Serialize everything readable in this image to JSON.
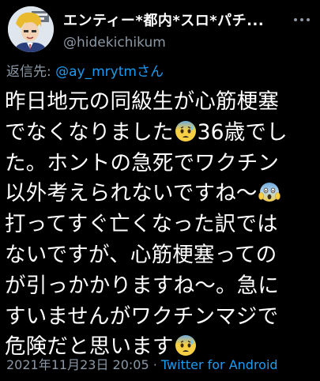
{
  "tweet": {
    "display_name": "エンティー*都内*スロ*パチ...",
    "handle": "@hidekichikum",
    "reply_prefix": "返信先: ",
    "reply_mention": "@ay_mrytmさん",
    "body_lines": [
      "昨日地元の同級生が心筋梗塞",
      "でなくなりました",
      "36歳でし",
      "た。ホントの急死でワクチン",
      "以外考えられないですね〜",
      "打ってすぐ亡くなった訳では",
      "ないですが、心筋梗塞っての",
      "が引っかかりますね〜。急に",
      "すいませんがワクチンマジで",
      "危険だと思います"
    ],
    "timestamp": "2021年11月23日 20:05",
    "separator": " · ",
    "source": "Twitter for Android"
  },
  "icons": {
    "avatar": "avatar-cartoon",
    "more": "more-icon",
    "emoji_1": "anxious-face-with-sweat-emoji",
    "emoji_2": "face-screaming-in-fear-emoji",
    "emoji_3": "anxious-face-with-sweat-emoji"
  },
  "colors": {
    "background": "#000000",
    "text": "#ffffff",
    "secondary": "#8b98a5",
    "link": "#1d9bf0"
  }
}
